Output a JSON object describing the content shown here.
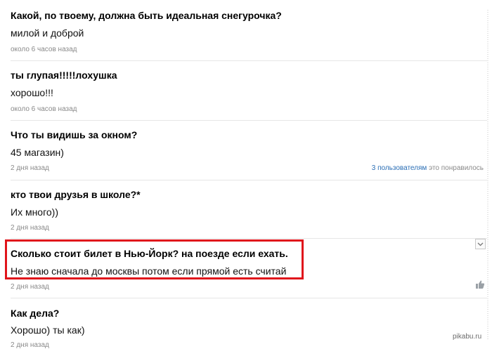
{
  "items": [
    {
      "question": "Какой, по твоему, должна быть идеальная снегурочка?",
      "answer": "милой и доброй",
      "time": "около 6 часов назад"
    },
    {
      "question": "ты глупая!!!!!лохушка",
      "answer": "хорошо!!!",
      "time": "около 6 часов назад"
    },
    {
      "question": "Что ты видишь за окном?",
      "answer": "45 магазин)",
      "time": "2 дня назад",
      "likes_link": "3 пользователям",
      "likes_text": "это понравилось"
    },
    {
      "question": "кто твои друзья в школе?*",
      "answer": "Их много))",
      "time": "2 дня назад"
    },
    {
      "question": "Сколько стоит билет в Нью-Йорк? на поезде если ехать.",
      "answer": "Не знаю сначала до москвы потом если прямой есть считай",
      "time": "2 дня назад"
    },
    {
      "question": "Как дела?",
      "answer": "Хорошо) ты как)",
      "time": "2 дня назад"
    }
  ],
  "watermark": "pikabu.ru",
  "icons": {
    "dropdown": "chevron-down-icon",
    "like": "thumbs-up-icon"
  },
  "colors": {
    "highlight": "#e0141b",
    "link": "#2a6eb5"
  }
}
